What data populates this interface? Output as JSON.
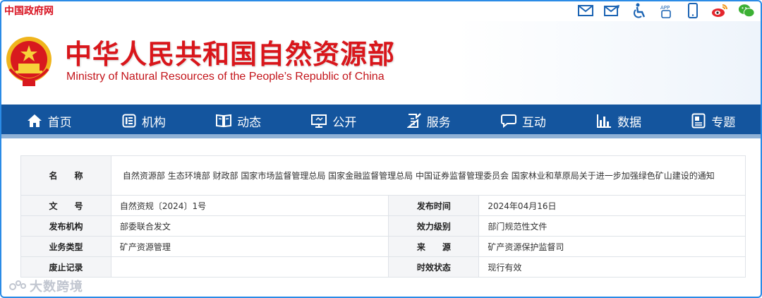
{
  "topbar": {
    "gov_link": "中国政府网",
    "icons": [
      "mail-icon",
      "mail-edit-icon",
      "accessibility-icon",
      "app-icon",
      "mobile-icon",
      "weibo-icon",
      "wechat-icon"
    ],
    "app_label": "APP"
  },
  "header": {
    "title_cn": "中华人民共和国自然资源部",
    "title_en": "Ministry of Natural Resources of the People’s Republic of China"
  },
  "nav": {
    "items": [
      {
        "label": "首页",
        "icon": "home-icon"
      },
      {
        "label": "机构",
        "icon": "org-icon"
      },
      {
        "label": "动态",
        "icon": "book-icon"
      },
      {
        "label": "公开",
        "icon": "monitor-icon"
      },
      {
        "label": "服务",
        "icon": "doc-edit-icon"
      },
      {
        "label": "互动",
        "icon": "chat-icon"
      },
      {
        "label": "数据",
        "icon": "bar-chart-icon"
      },
      {
        "label": "专题",
        "icon": "topic-icon"
      }
    ]
  },
  "info": {
    "name_key": "名　　称",
    "name_value": "自然资源部 生态环境部 财政部 国家市场监督管理总局 国家金融监督管理总局 中国证券监督管理委员会 国家林业和草原局关于进一步加强绿色矿山建设的通知",
    "rows": [
      {
        "k1": "文　　号",
        "v1": "自然资规〔2024〕1号",
        "k2": "发布时间",
        "v2": "2024年04月16日"
      },
      {
        "k1": "发布机构",
        "v1": "部委联合发文",
        "k2": "效力级别",
        "v2": "部门规范性文件"
      },
      {
        "k1": "业务类型",
        "v1": "矿产资源管理",
        "k2": "来　　源",
        "v2": "矿产资源保护监督司"
      },
      {
        "k1": "废止记录",
        "v1": "",
        "k2": "时效状态",
        "v2": "现行有效"
      }
    ]
  },
  "watermark": "大数跨境",
  "colors": {
    "nav_bg": "#14559e",
    "title_red": "#d9161b",
    "frame_blue": "#2b8be6"
  }
}
